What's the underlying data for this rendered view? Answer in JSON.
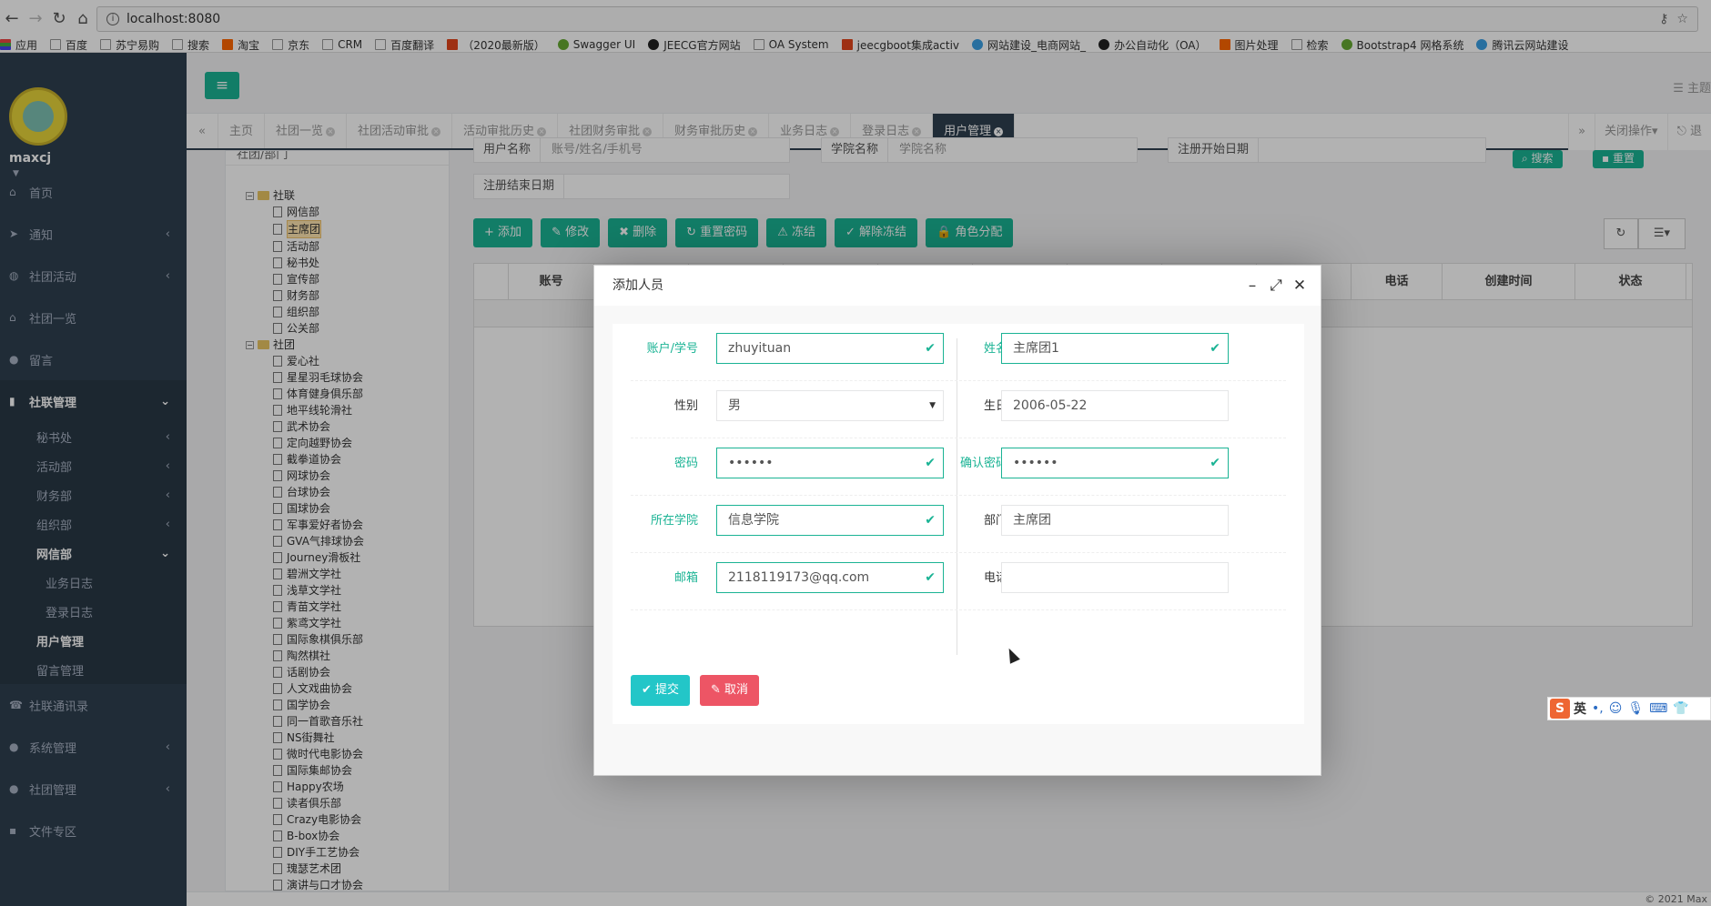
{
  "browser": {
    "url": "localhost:8080",
    "bookmarks": [
      {
        "label": "应用",
        "icon": "apps-icon"
      },
      {
        "label": "百度",
        "icon": "page-icon"
      },
      {
        "label": "苏宁易购",
        "icon": "page-icon"
      },
      {
        "label": "搜索",
        "icon": "page-icon"
      },
      {
        "label": "淘宝",
        "icon": "taobao-icon"
      },
      {
        "label": "京东",
        "icon": "page-icon"
      },
      {
        "label": "CRM",
        "icon": "page-icon"
      },
      {
        "label": "百度翻译",
        "icon": "page-icon"
      },
      {
        "label": "（2020最新版）",
        "icon": "c-icon"
      },
      {
        "label": "Swagger UI",
        "icon": "swagger-icon"
      },
      {
        "label": "JEECG官方网站",
        "icon": "jeecg-icon"
      },
      {
        "label": "OA System",
        "icon": "page-icon"
      },
      {
        "label": "jeecgboot集成activ",
        "icon": "g-icon"
      },
      {
        "label": "网站建设_电商网站_",
        "icon": "cloud-icon"
      },
      {
        "label": "办公自动化（OA）",
        "icon": "github-icon"
      },
      {
        "label": "图片处理",
        "icon": "office-icon"
      },
      {
        "label": "检索",
        "icon": "search-icon"
      },
      {
        "label": "Bootstrap4 网格系统",
        "icon": "runoob-icon"
      },
      {
        "label": "腾讯云网站建设",
        "icon": "cloud-icon"
      }
    ]
  },
  "sidebar": {
    "username": "maxcj",
    "items": [
      {
        "label": "首页",
        "icon": "home-icon",
        "type": "top"
      },
      {
        "label": "通知",
        "icon": "send-icon",
        "type": "top",
        "arrow": "‹"
      },
      {
        "label": "社团活动",
        "icon": "globe-icon",
        "type": "top",
        "arrow": "‹"
      },
      {
        "label": "社团一览",
        "icon": "bank-icon",
        "type": "top"
      },
      {
        "label": "留言",
        "icon": "comment-icon",
        "type": "top"
      },
      {
        "label": "社联管理",
        "icon": "bookmark-icon",
        "type": "active",
        "arrow": "⌄"
      },
      {
        "label": "秘书处",
        "type": "sub",
        "arrow": "‹"
      },
      {
        "label": "活动部",
        "type": "sub",
        "arrow": "‹"
      },
      {
        "label": "财务部",
        "type": "sub",
        "arrow": "‹"
      },
      {
        "label": "组织部",
        "type": "sub",
        "arrow": "‹"
      },
      {
        "label": "网信部",
        "type": "subhl",
        "arrow": "⌄"
      },
      {
        "label": "业务日志",
        "type": "sub2"
      },
      {
        "label": "登录日志",
        "type": "sub2"
      },
      {
        "label": "用户管理",
        "type": "subhl"
      },
      {
        "label": "留言管理",
        "type": "sub"
      },
      {
        "label": "社联通讯录",
        "icon": "phone-icon",
        "type": "top"
      },
      {
        "label": "系统管理",
        "icon": "user-icon",
        "type": "top",
        "arrow": "‹"
      },
      {
        "label": "社团管理",
        "icon": "group-icon",
        "type": "top",
        "arrow": "‹"
      },
      {
        "label": "文件专区",
        "icon": "file-icon",
        "type": "top"
      }
    ]
  },
  "header": {
    "theme_label": "主题"
  },
  "tabs": [
    {
      "label": "主页",
      "closable": false
    },
    {
      "label": "社团一览",
      "closable": true
    },
    {
      "label": "社团活动审批",
      "closable": true
    },
    {
      "label": "活动审批历史",
      "closable": true
    },
    {
      "label": "社团财务审批",
      "closable": true
    },
    {
      "label": "财务审批历史",
      "closable": true
    },
    {
      "label": "业务日志",
      "closable": true
    },
    {
      "label": "登录日志",
      "closable": true
    },
    {
      "label": "用户管理",
      "closable": true,
      "active": true
    }
  ],
  "tab_right": {
    "close_ops": "关闭操作▾",
    "logout": "退"
  },
  "tree": {
    "header": "社团/部门",
    "groups": [
      {
        "label": "社联",
        "children": [
          "网信部",
          "主席团",
          "活动部",
          "秘书处",
          "宣传部",
          "财务部",
          "组织部",
          "公关部"
        ],
        "selected": "主席团"
      },
      {
        "label": "社团",
        "children": [
          "爱心社",
          "星星羽毛球协会",
          "体育健身俱乐部",
          "地平线轮滑社",
          "武术协会",
          "定向越野协会",
          "截拳道协会",
          "网球协会",
          "台球协会",
          "国球协会",
          "军事爱好者协会",
          "GVA气排球协会",
          "Journey滑板社",
          "碧洲文学社",
          "浅草文学社",
          "青苗文学社",
          "紫鸢文学社",
          "国际象棋俱乐部",
          "陶然棋社",
          "话剧协会",
          "人文戏曲协会",
          "国学协会",
          "同一首歌音乐社",
          "NS街舞社",
          "微时代电影协会",
          "国际集邮协会",
          "Happy农场",
          "读者俱乐部",
          "Crazy电影协会",
          "B-box协会",
          "DIY手工艺协会",
          "瑰瑟艺术团",
          "演讲与口才协会"
        ]
      }
    ]
  },
  "search": {
    "username_label": "用户名称",
    "username_ph": "账号/姓名/手机号",
    "college_label": "学院名称",
    "college_ph": "学院名称",
    "start_label": "注册开始日期",
    "end_label": "注册结束日期",
    "search_btn": "搜索",
    "reset_btn": "重置"
  },
  "toolbar": [
    {
      "label": "添加",
      "icon": "plus-icon",
      "glyph": "+"
    },
    {
      "label": "修改",
      "icon": "edit-icon",
      "glyph": "✎"
    },
    {
      "label": "删除",
      "icon": "remove-icon",
      "glyph": "✖"
    },
    {
      "label": "重置密码",
      "icon": "refresh-icon",
      "glyph": "↻"
    },
    {
      "label": "冻结",
      "icon": "warning-icon",
      "glyph": "⚠"
    },
    {
      "label": "解除冻结",
      "icon": "check-circle-icon",
      "glyph": "✓"
    },
    {
      "label": "角色分配",
      "icon": "lock-icon",
      "glyph": "🔒"
    }
  ],
  "grid": {
    "columns": [
      "",
      "账号",
      "",
      "",
      "",
      "",
      "",
      "",
      "",
      "",
      "电话",
      "创建时间",
      "状态"
    ]
  },
  "dialog": {
    "title": "添加人员",
    "fields": {
      "account": {
        "label": "账户/学号",
        "value": "zhuyituan",
        "valid": true
      },
      "name": {
        "label": "姓名",
        "value": "主席团1",
        "valid": true
      },
      "gender": {
        "label": "性别",
        "value": "男"
      },
      "birthday": {
        "label": "生日",
        "value": "2006-05-22"
      },
      "password": {
        "label": "密码",
        "value": "••••••",
        "valid": true
      },
      "confirm": {
        "label": "确认密码",
        "value": "••••••",
        "valid": true
      },
      "college": {
        "label": "所在学院",
        "value": "信息学院",
        "valid": true
      },
      "dept": {
        "label": "部门",
        "value": "主席团"
      },
      "email": {
        "label": "邮箱",
        "value": "2118119173@qq.com",
        "valid": true
      },
      "phone": {
        "label": "电话",
        "value": ""
      }
    },
    "submit": "提交",
    "cancel": "取消"
  },
  "ime": {
    "lang": "英"
  },
  "footer": "© 2021 Max",
  "colors": {
    "primary": "#1ab394",
    "sidebar": "#2f4050",
    "info": "#23c6c8",
    "danger": "#ed5565"
  }
}
